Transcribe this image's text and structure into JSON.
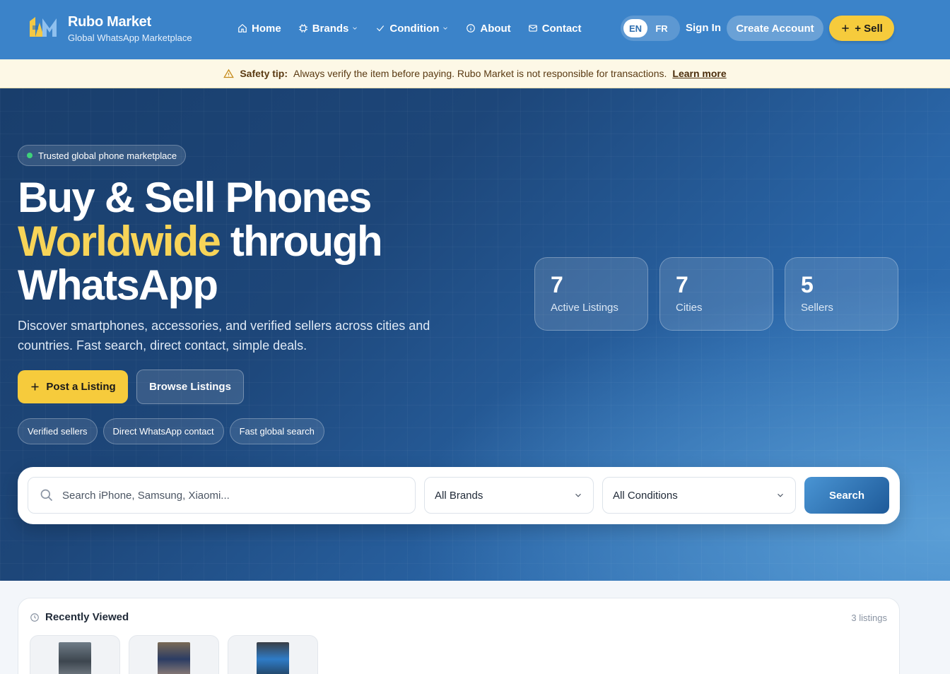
{
  "header": {
    "brand_name": "Rubo Market",
    "brand_sub": "Global WhatsApp Marketplace",
    "nav": [
      {
        "label": "Home",
        "icon": "home-icon"
      },
      {
        "label": "Brands",
        "icon": "chip-icon"
      },
      {
        "label": "Condition",
        "icon": "check-icon"
      },
      {
        "label": "About",
        "icon": "info-icon"
      },
      {
        "label": "Contact",
        "icon": "mail-icon"
      }
    ],
    "lang_en": "EN",
    "lang_fr": "FR",
    "sign_in": "Sign In",
    "create_account": "Create Account",
    "sell": "+ Sell"
  },
  "safety": {
    "label": "Safety tip:",
    "text": "Always verify the item before paying. Rubo Market is not responsible for transactions.",
    "link": "Learn more"
  },
  "hero": {
    "pill": "Trusted global phone marketplace",
    "title_line1": "Buy & Sell Phones",
    "title_highlight": "Worldwide",
    "title_rest": " through",
    "title_line3": "WhatsApp",
    "description": "Discover smartphones, accessories, and verified sellers across cities and countries. Fast search, direct contact, simple deals.",
    "post_button": "Post a Listing",
    "browse_button": "Browse Listings",
    "tags": [
      "Verified sellers",
      "Direct WhatsApp contact",
      "Fast global search"
    ],
    "stats": [
      {
        "value": "7",
        "label": "Active Listings"
      },
      {
        "value": "7",
        "label": "Cities"
      },
      {
        "value": "5",
        "label": "Sellers"
      }
    ]
  },
  "search": {
    "placeholder": "Search iPhone, Samsung, Xiaomi...",
    "brand_select": "All Brands",
    "condition_select": "All Conditions",
    "button": "Search"
  },
  "recent": {
    "title": "Recently Viewed",
    "count": "3 listings"
  },
  "colors": {
    "header_bg": "#3b83c9",
    "accent_yellow": "#f6cb3c",
    "hero_dark": "#193e6c",
    "highlight": "#f7d458"
  }
}
